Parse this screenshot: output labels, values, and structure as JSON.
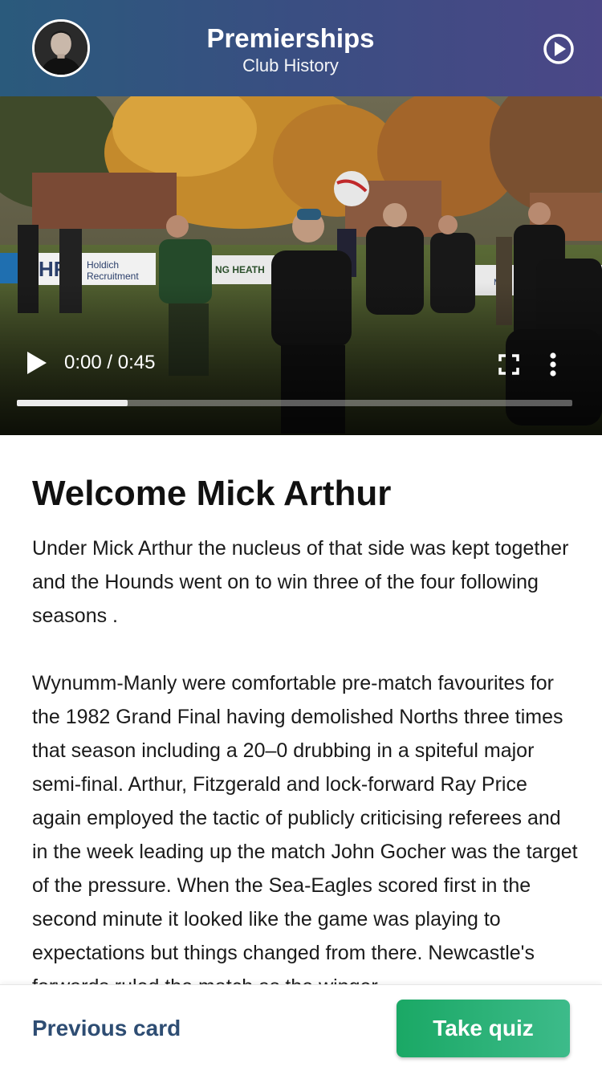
{
  "header": {
    "title": "Premierships",
    "subtitle": "Club History",
    "avatar_icon": "user-avatar",
    "play_icon": "play-circle-icon"
  },
  "video": {
    "time": "0:00 / 0:45",
    "progress": 0.2,
    "controls": {
      "play_icon": "play-icon",
      "fullscreen_icon": "fullscreen-icon",
      "more_icon": "more-vertical-icon"
    },
    "banner_text": [
      "HR",
      "Holdich",
      "Recruitment",
      "NG HEATH",
      "M+A"
    ]
  },
  "article": {
    "heading": "Welcome Mick Arthur",
    "paragraphs": [
      "Under Mick Arthur the nucleus of that side was kept together and the Hounds went on to win three of the four following seasons .",
      "Wynumm-Manly were comfortable pre-match favourites for the 1982 Grand Final having demolished Norths three times that season including a 20–0 drubbing in a spiteful major semi-final. Arthur, Fitzgerald and lock-forward Ray Price again employed the tactic of publicly criticising referees and in the week leading up the match John Gocher was the target of the pressure. When the Sea-Eagles scored first in the second minute it looked like the game was playing to expectations but things changed from there. Newcastle's forwards ruled the match as the winger"
    ]
  },
  "footer": {
    "previous_label": "Previous card",
    "quiz_label": "Take quiz"
  },
  "colors": {
    "header_start": "#2a5a7c",
    "header_end": "#4b4787",
    "accent_green": "#1aa865",
    "link_blue": "#2e4d73"
  }
}
